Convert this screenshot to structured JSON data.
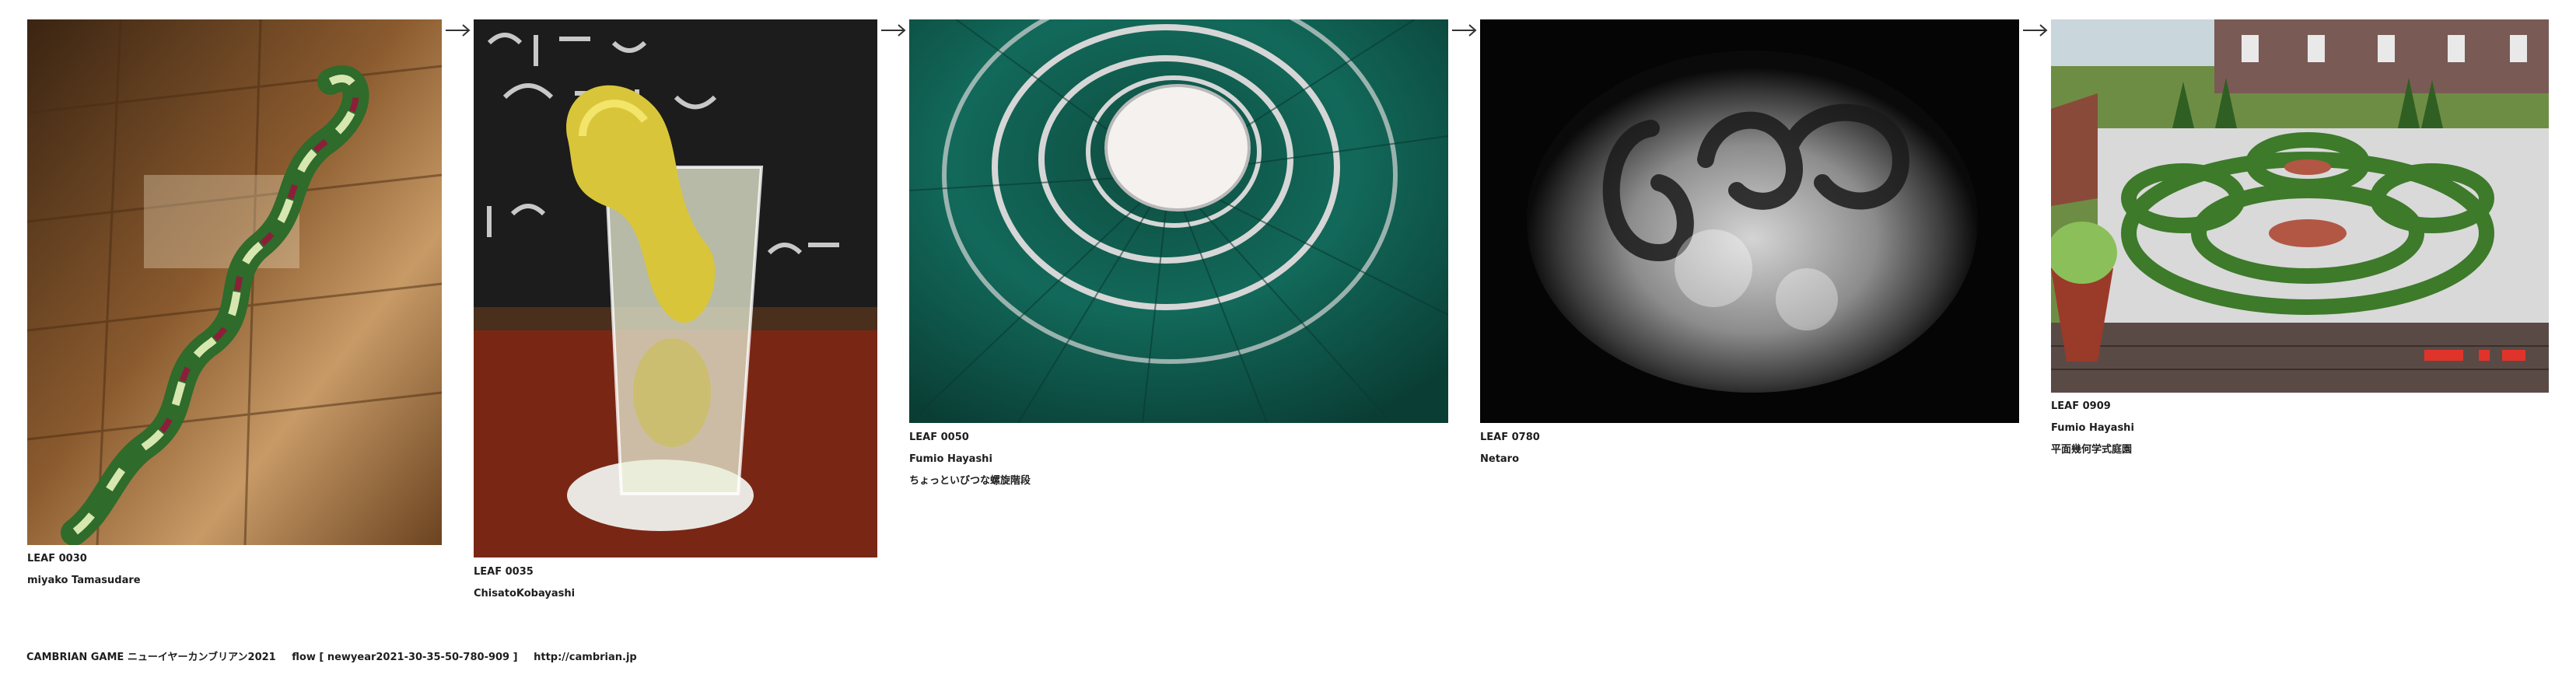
{
  "arrow_icon": "right-arrow-icon",
  "items": [
    {
      "code": "LEAF 0030",
      "author": "miyako Tamasudare",
      "title": "",
      "image": "twisted-variegated-leaf-on-wooden-floor"
    },
    {
      "code": "LEAF 0035",
      "author": "ChisatoKobayashi",
      "title": "",
      "image": "lemon-sour-highball-glass"
    },
    {
      "code": "LEAF 0050",
      "author": "Fumio Hayashi",
      "title": "ちょっといびつな螺旋階段",
      "image": "green-spiral-staircase"
    },
    {
      "code": "LEAF 0780",
      "author": "Netaro",
      "title": "",
      "image": "sand-pattern-on-black"
    },
    {
      "code": "LEAF 0909",
      "author": "Fumio Hayashi",
      "title": "平面幾何学式庭園",
      "image": "formal-geometric-garden"
    }
  ],
  "footer": {
    "site": "CAMBRIAN GAME",
    "event": "ニューイヤーカンブリアン2021",
    "flow": "flow [ newyear2021-30-35-50-780-909 ]",
    "url": "http://cambrian.jp"
  }
}
